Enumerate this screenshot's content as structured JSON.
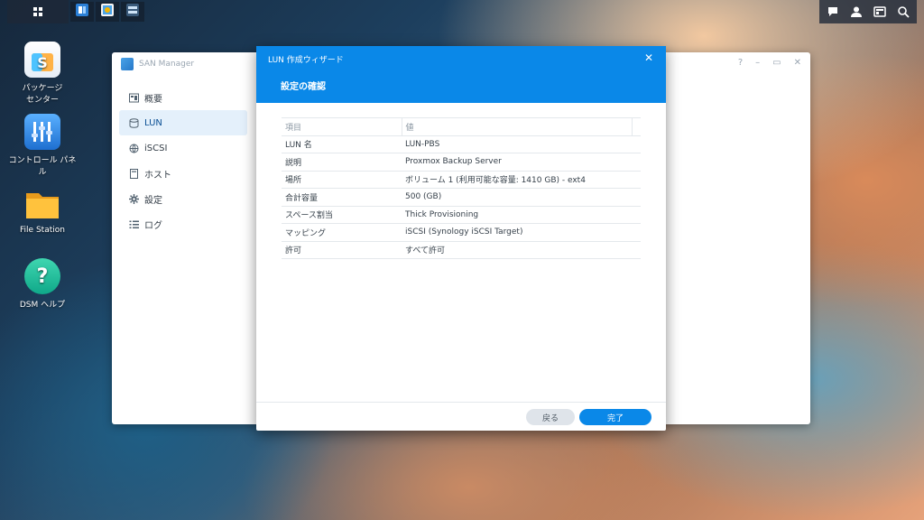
{
  "taskbar": {
    "main_menu_icon": "grid-icon",
    "apps": [
      "san-manager-icon",
      "image-app-icon",
      "storage-app-icon"
    ],
    "right_icons": [
      "chat-icon",
      "user-icon",
      "widgets-icon",
      "search-icon"
    ]
  },
  "desktop": {
    "icons": [
      {
        "label": "パッケージ\nセンター",
        "icon": "package-center-icon"
      },
      {
        "label": "コントロール パネル",
        "icon": "control-panel-icon"
      },
      {
        "label": "File Station",
        "icon": "folder-icon"
      },
      {
        "label": "DSM ヘルプ",
        "icon": "help-icon"
      }
    ]
  },
  "san_manager": {
    "title": "SAN Manager",
    "controls": [
      "?",
      "–",
      "▭",
      "✕"
    ],
    "sidebar": [
      {
        "label": "概要",
        "icon": "overview-icon"
      },
      {
        "label": "LUN",
        "icon": "database-icon"
      },
      {
        "label": "iSCSI",
        "icon": "globe-icon"
      },
      {
        "label": "ホスト",
        "icon": "host-icon"
      },
      {
        "label": "設定",
        "icon": "gear-icon"
      },
      {
        "label": "ログ",
        "icon": "list-icon"
      }
    ],
    "active_sidebar": "LUN"
  },
  "wizard": {
    "title": "LUN 作成ウィザード",
    "close": "✕",
    "step_title": "設定の確認",
    "table": {
      "headers": [
        "項目",
        "値"
      ],
      "rows": [
        [
          "LUN 名",
          "LUN-PBS"
        ],
        [
          "説明",
          "Proxmox Backup Server"
        ],
        [
          "場所",
          "ボリューム 1 (利用可能な容量: 1410 GB) - ext4"
        ],
        [
          "合計容量",
          "500 (GB)"
        ],
        [
          "スペース割当",
          "Thick Provisioning"
        ],
        [
          "マッピング",
          "iSCSI (Synology iSCSI Target)"
        ],
        [
          "許可",
          "すべて許可"
        ]
      ]
    },
    "back_label": "戻る",
    "finish_label": "完了"
  },
  "colors": {
    "accent": "#0a88e8",
    "sidebar_active_bg": "#e4f0fb"
  }
}
